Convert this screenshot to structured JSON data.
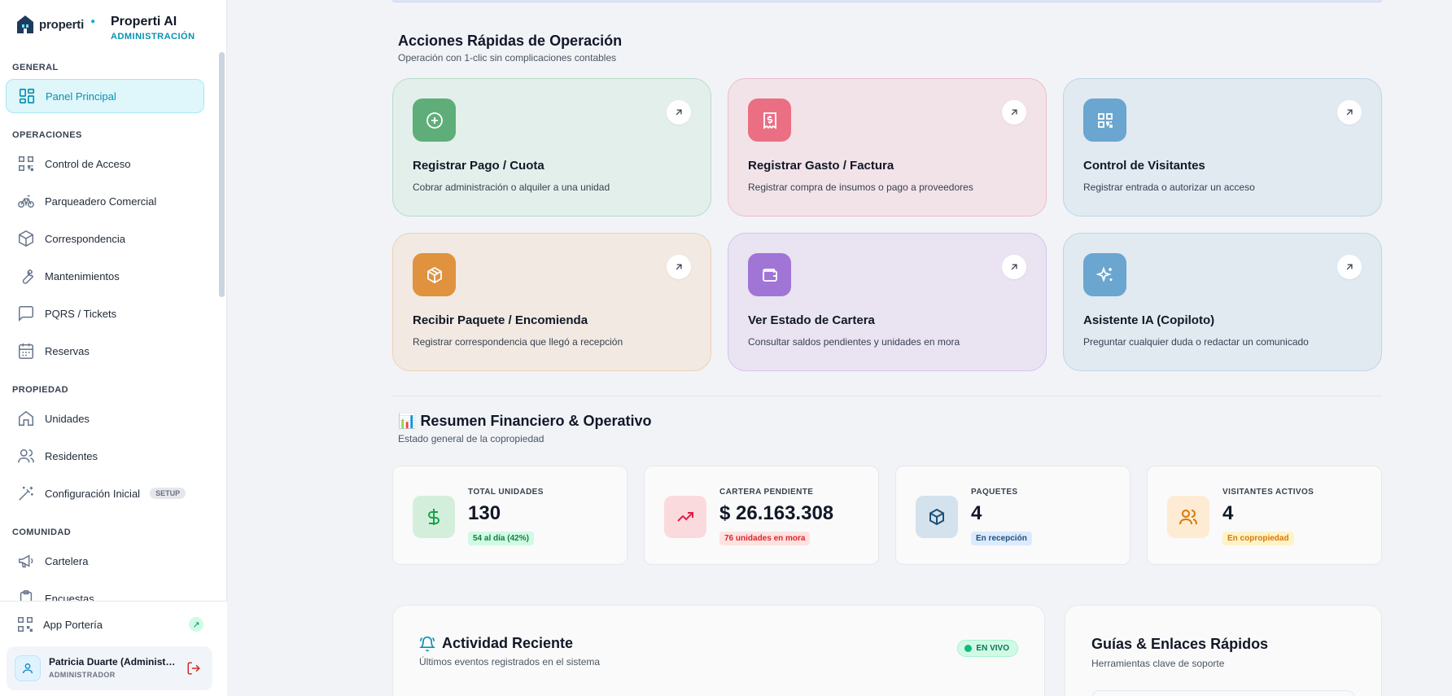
{
  "brand": {
    "name": "properti",
    "app_title": "Properti AI",
    "app_subtitle": "ADMINISTRACIÓN"
  },
  "sidebar": {
    "sections": {
      "general": "GENERAL",
      "operaciones": "OPERACIONES",
      "propiedad": "PROPIEDAD",
      "comunidad": "COMUNIDAD"
    },
    "items": {
      "panel": "Panel Principal",
      "acceso": "Control de Acceso",
      "parqueadero": "Parqueadero Comercial",
      "correspondencia": "Correspondencia",
      "mantenimientos": "Mantenimientos",
      "pqrs": "PQRS / Tickets",
      "reservas": "Reservas",
      "unidades": "Unidades",
      "residentes": "Residentes",
      "configuracion": "Configuración Inicial",
      "cartelera": "Cartelera",
      "encuestas": "Encuestas"
    },
    "setup_badge": "SETUP",
    "porteria": "App Portería",
    "user": {
      "name": "Patricia Duarte (Administradora)",
      "role": "ADMINISTRADOR"
    }
  },
  "quick": {
    "title": "Acciones Rápidas de Operación",
    "subtitle": "Operación con 1-clic sin complicaciones contables",
    "cards": [
      {
        "title": "Registrar Pago / Cuota",
        "desc": "Cobrar administración o alquiler a una unidad",
        "icon": "plus-circle-icon"
      },
      {
        "title": "Registrar Gasto / Factura",
        "desc": "Registrar compra de insumos o pago a proveedores",
        "icon": "receipt-icon"
      },
      {
        "title": "Control de Visitantes",
        "desc": "Registrar entrada o autorizar un acceso",
        "icon": "qr-icon"
      },
      {
        "title": "Recibir Paquete / Encomienda",
        "desc": "Registrar correspondencia que llegó a recepción",
        "icon": "package-icon"
      },
      {
        "title": "Ver Estado de Cartera",
        "desc": "Consultar saldos pendientes y unidades en mora",
        "icon": "wallet-icon"
      },
      {
        "title": "Asistente IA (Copiloto)",
        "desc": "Preguntar cualquier duda o redactar un comunicado",
        "icon": "sparkles-icon"
      }
    ]
  },
  "summary": {
    "emoji": "📊",
    "title": "Resumen Financiero & Operativo",
    "subtitle": "Estado general de la copropiedad",
    "stats": [
      {
        "label": "TOTAL UNIDADES",
        "value": "130",
        "badge": "54 al día (42%)"
      },
      {
        "label": "CARTERA PENDIENTE",
        "value": "$ 26.163.308",
        "badge": "76 unidades en mora"
      },
      {
        "label": "PAQUETES",
        "value": "4",
        "badge": "En recepción"
      },
      {
        "label": "VISITANTES ACTIVOS",
        "value": "4",
        "badge": "En copropiedad"
      }
    ]
  },
  "activity": {
    "title": "Actividad Reciente",
    "subtitle": "Últimos eventos registrados en el sistema",
    "live": "EN VIVO"
  },
  "guides": {
    "title": "Guías & Enlaces Rápidos",
    "subtitle": "Herramientas clave de soporte"
  },
  "colors": {
    "accent": "#0891b2",
    "green": "#5fae79",
    "red": "#ea6f83",
    "blue": "#6aa6cf",
    "orange": "#e0923e",
    "purple": "#a075d6"
  }
}
